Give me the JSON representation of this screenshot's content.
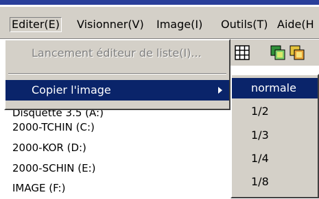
{
  "menubar": {
    "items": [
      {
        "label": "Editer(E)"
      },
      {
        "label": "Visionner(V)"
      },
      {
        "label": "Image(I)"
      },
      {
        "label": "Outils(T)"
      },
      {
        "label": "Aide(H"
      }
    ]
  },
  "dropdown": {
    "items": [
      {
        "label": "Lancement éditeur de liste(I)...",
        "disabled": true
      },
      {
        "label": "Copier l'image",
        "highlighted": true,
        "has_submenu": true
      }
    ]
  },
  "submenu": {
    "items": [
      {
        "label": "normale",
        "highlighted": true
      },
      {
        "label": "1/2"
      },
      {
        "label": "1/3"
      },
      {
        "label": "1/4"
      },
      {
        "label": "1/8"
      }
    ]
  },
  "drives": [
    {
      "label": "Disquette 3.5 (A:)"
    },
    {
      "label": "2000-TCHIN (C:)"
    },
    {
      "label": "2000-KOR (D:)"
    },
    {
      "label": "2000-SCHIN (E:)"
    },
    {
      "label": "IMAGE (F:)"
    }
  ],
  "colors": {
    "menu_bg": "#d4d0c8",
    "highlight": "#0a246a",
    "disabled_text": "#808080"
  },
  "icons": {
    "toolbar": [
      "grid-view-icon",
      "copy-image-icon",
      "paste-image-icon"
    ]
  }
}
